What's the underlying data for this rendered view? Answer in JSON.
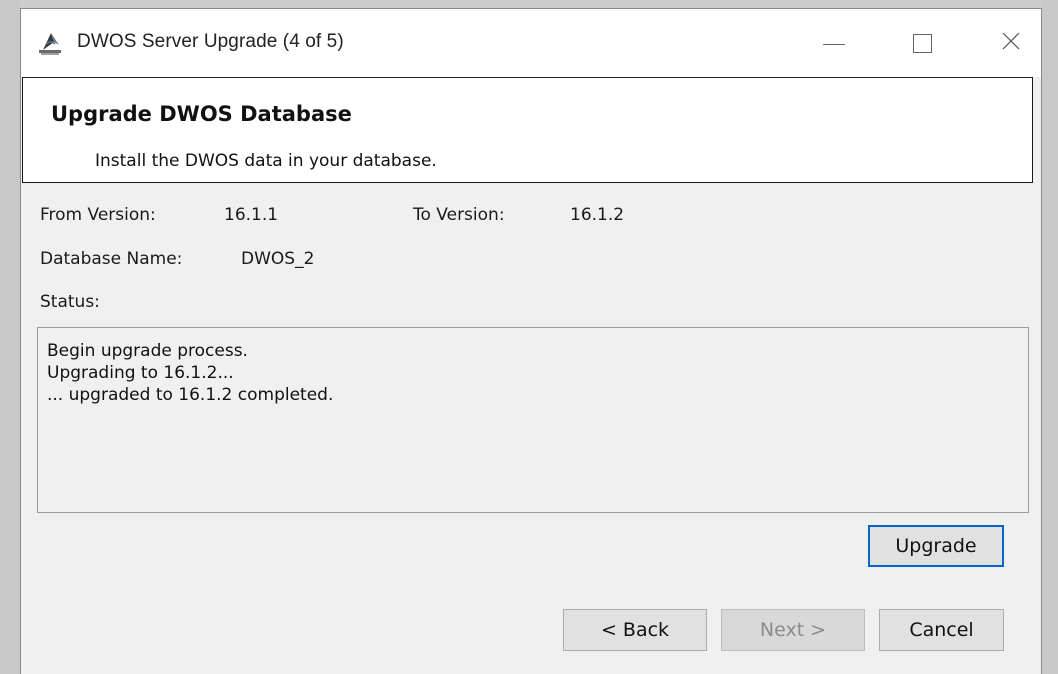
{
  "window": {
    "title": "DWOS Server Upgrade (4 of 5)",
    "app_icon": "dwos-app-icon",
    "controls": {
      "minimize_icon": "minimize-icon",
      "maximize_icon": "maximize-icon",
      "close_icon": "close-icon"
    }
  },
  "header": {
    "title": "Upgrade DWOS Database",
    "subtitle": "Install the DWOS data in your database."
  },
  "fields": {
    "from_version_label": "From Version:",
    "from_version_value": "16.1.1",
    "to_version_label": "To Version:",
    "to_version_value": "16.1.2",
    "database_name_label": "Database Name:",
    "database_name_value": "DWOS_2",
    "status_label": "Status:"
  },
  "status_log": [
    "Begin upgrade process.",
    "Upgrading to 16.1.2...",
    "... upgraded to 16.1.2 completed."
  ],
  "buttons": {
    "upgrade": "Upgrade",
    "back": "< Back",
    "next": "Next >",
    "cancel": "Cancel"
  },
  "states": {
    "next_enabled": false,
    "upgrade_focused": true
  },
  "colors": {
    "focus_border": "#0a64c8",
    "window_bg": "#f0f0f0",
    "header_bg": "#ffffff",
    "disabled_text": "#8c8c8c"
  }
}
